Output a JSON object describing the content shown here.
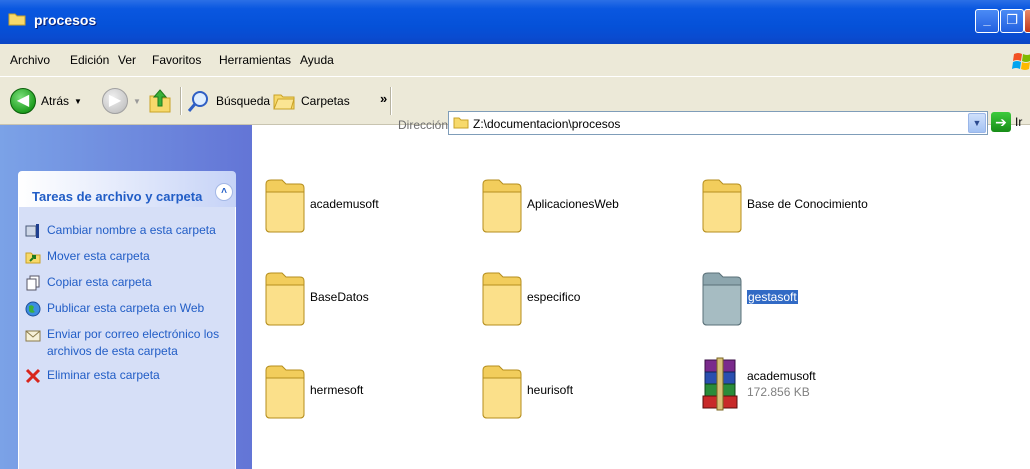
{
  "window": {
    "title": "procesos",
    "colors": {
      "titlebar": "#0551d8",
      "taskpane": "#7ba2e7",
      "selection": "#316ac5"
    }
  },
  "menu": {
    "items": [
      "Archivo",
      "Edición",
      "Ver",
      "Favoritos",
      "Herramientas",
      "Ayuda"
    ]
  },
  "toolbar": {
    "back_label": "Atrás",
    "search_label": "Búsqueda",
    "folders_label": "Carpetas",
    "overflow_label": "»",
    "address_label": "Dirección",
    "address_value": "Z:\\documentacion\\procesos",
    "go_label": "Ir"
  },
  "tasks": {
    "title": "Tareas de archivo y carpeta",
    "collapse_glyph": "˄",
    "items": [
      {
        "label": "Cambiar nombre a esta carpeta",
        "icon": "rename-icon"
      },
      {
        "label": "Mover esta carpeta",
        "icon": "move-folder-icon"
      },
      {
        "label": "Copiar esta carpeta",
        "icon": "copy-icon"
      },
      {
        "label": "Publicar esta carpeta en Web",
        "icon": "globe-icon"
      },
      {
        "label": "Enviar por correo electrónico los archivos de esta carpeta",
        "icon": "email-icon"
      },
      {
        "label": "Eliminar esta carpeta",
        "icon": "delete-x-icon"
      }
    ]
  },
  "files": [
    {
      "name": "academusoft",
      "type": "folder"
    },
    {
      "name": "AplicacionesWeb",
      "type": "folder"
    },
    {
      "name": "Base de Conocimiento",
      "type": "folder"
    },
    {
      "name": "BaseDatos",
      "type": "folder"
    },
    {
      "name": "especifico",
      "type": "folder"
    },
    {
      "name": "gestasoft",
      "type": "folder",
      "selected": true
    },
    {
      "name": "hermesoft",
      "type": "folder"
    },
    {
      "name": "heurisoft",
      "type": "folder"
    },
    {
      "name": "academusoft",
      "type": "rar-archive",
      "size": "172.856 KB"
    }
  ]
}
